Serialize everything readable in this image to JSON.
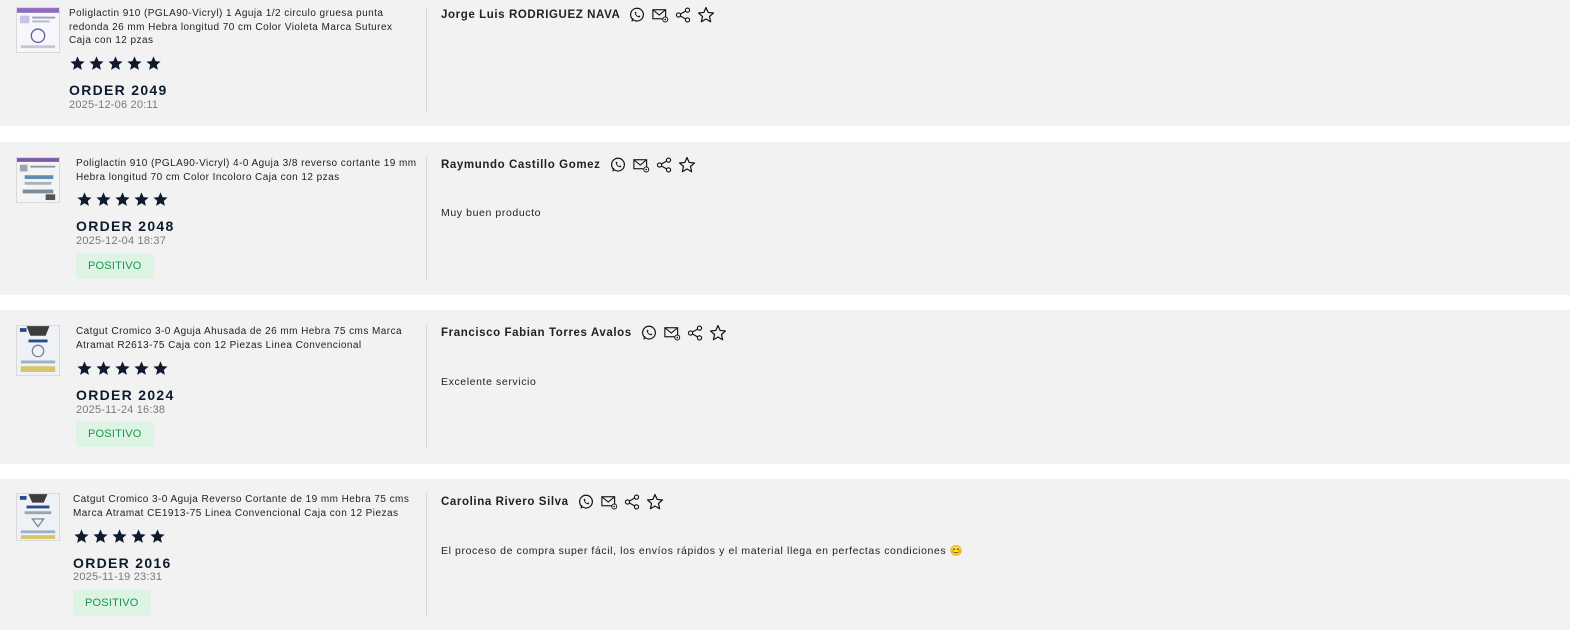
{
  "accent_color": "#0f1b2d",
  "badge_colors": {
    "background": "#ddf3e4",
    "text": "#17984a"
  },
  "icons": [
    "whatsapp-icon",
    "email-icon",
    "share-icon",
    "star-outline-icon",
    "star-filled-icon"
  ],
  "reviews": [
    {
      "product": "Poliglactin 910 (PGLA90-Vicryl) 1 Aguja 1/2 circulo gruesa punta redonda 26 mm Hebra longitud 70 cm Color Violeta Marca Suturex Caja con 12 pzas",
      "rating": 5,
      "order": "ORDER 2049",
      "date": "2025-12-06 20:11",
      "customer": "Jorge Luis RODRIGUEZ NAVA",
      "comment": "",
      "badge": ""
    },
    {
      "product": "Poliglactin 910 (PGLA90-Vicryl) 4-0 Aguja 3/8 reverso cortante 19 mm Hebra longitud 70 cm Color Incoloro Caja con 12 pzas",
      "rating": 5,
      "order": "ORDER 2048",
      "date": "2025-12-04 18:37",
      "customer": "Raymundo Castillo Gomez",
      "comment": "Muy buen producto",
      "badge": "POSITIVO"
    },
    {
      "product": "Catgut Cromico 3-0 Aguja Ahusada de 26 mm Hebra 75 cms Marca Atramat R2613-75 Caja con 12 Piezas Linea Convencional",
      "rating": 5,
      "order": "ORDER 2024",
      "date": "2025-11-24 16:38",
      "customer": "Francisco Fabian Torres Avalos",
      "comment": "Excelente servicio",
      "badge": "POSITIVO"
    },
    {
      "product": "Catgut Cromico 3-0 Aguja Reverso Cortante de 19 mm Hebra 75 cms Marca Atramat CE1913-75 Linea Convencional Caja con 12 Piezas",
      "rating": 5,
      "order": "ORDER 2016",
      "date": "2025-11-19 23:31",
      "customer": "Carolina Rivero Silva",
      "comment": "El proceso de compra super fácil, los envíos rápidos y el material llega en perfectas condiciones 😊",
      "badge": "POSITIVO"
    }
  ]
}
